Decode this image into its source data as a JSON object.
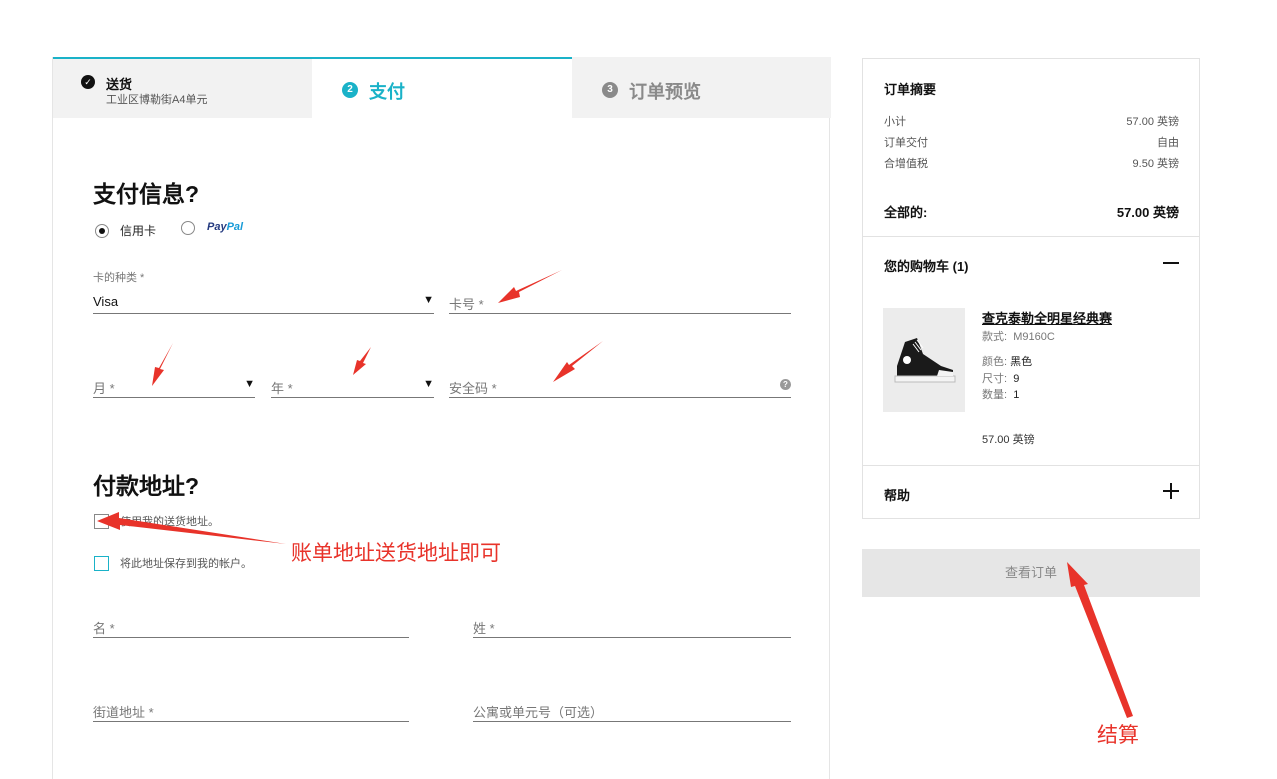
{
  "steps": {
    "shipping": {
      "title": "送货",
      "address": "工业区博勒街A4单元",
      "check": "✓"
    },
    "payment": {
      "num": "2",
      "label": "支付"
    },
    "review": {
      "num": "3",
      "label": "订单预览"
    }
  },
  "payment_info": {
    "heading": "支付信息?",
    "method_credit": "信用卡",
    "method_paypal": "PayPal",
    "card_type_label": "卡的种类 *",
    "card_type_value": "Visa",
    "card_number_placeholder": "卡号 *",
    "month_placeholder": "月 *",
    "year_placeholder": "年 *",
    "cvv_placeholder": "安全码 *",
    "help_glyph": "?"
  },
  "billing": {
    "heading": "付款地址?",
    "use_shipping_label": "使用我的送货地址。",
    "save_address_label": "将此地址保存到我的帐户。",
    "first_name": "名 *",
    "last_name": "姓 *",
    "street": "街道地址 *",
    "apartment": "公寓或单元号（可选）"
  },
  "summary": {
    "title": "订单摘要",
    "rows": [
      {
        "label": "小计",
        "value": "57.00 英镑"
      },
      {
        "label": "订单交付",
        "value": "自由"
      },
      {
        "label": "合增值税",
        "value": "9.50 英镑"
      }
    ],
    "total_label": "全部的:",
    "total_value": "57.00 英镑",
    "cart_title": "您的购物车 (1)",
    "product": {
      "name": "查克泰勒全明星经典赛",
      "style_label": "款式:",
      "style_value": "M9160C",
      "color_label": "颜色:",
      "color_value": "黑色",
      "size_label": "尺寸:",
      "size_value": "9",
      "qty_label": "数量:",
      "qty_value": "1",
      "price": "57.00 英镑"
    },
    "help_title": "帮助"
  },
  "review_button": "查看订单",
  "annotations": {
    "billing_note": "账单地址送货地址即可",
    "checkout_note": "结算"
  },
  "colors": {
    "accent": "#1ab2c8",
    "annotation": "#e8332a",
    "paypal_dark": "#253b80",
    "paypal_light": "#179bd7"
  }
}
